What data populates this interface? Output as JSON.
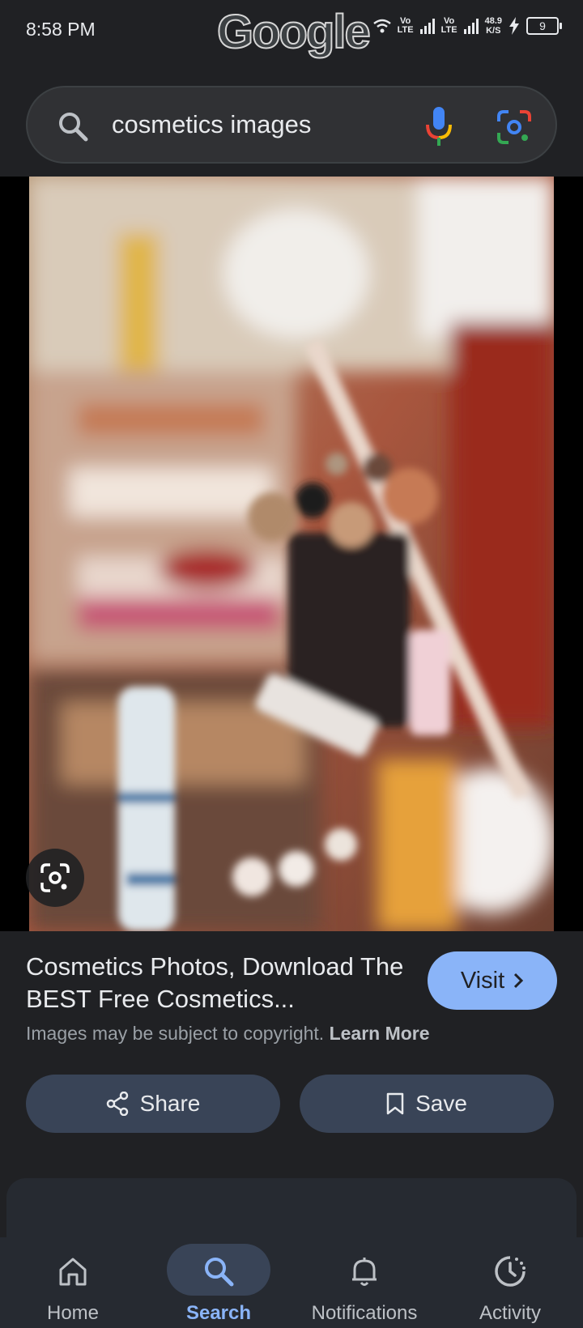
{
  "status_bar": {
    "time": "8:58 PM",
    "logo_text": "Google",
    "sim1_label_top": "Vo",
    "sim1_label_bottom": "LTE",
    "sim2_label_top": "Vo",
    "sim2_label_bottom": "LTE",
    "speed_value": "48.9",
    "speed_unit": "K/S",
    "battery_level": "9"
  },
  "search": {
    "query": "cosmetics images",
    "icons": [
      "search-icon",
      "mic-icon",
      "lens-icon"
    ]
  },
  "image_viewer": {
    "image_alt": "cosmetics brushes and makeup products photo",
    "lens_button_icon": "lens-icon"
  },
  "result": {
    "title": "Cosmetics Photos, Download The BEST Free Cosmetics...",
    "copyright_text": "Images may be subject to copyright.",
    "learn_more": "Learn More",
    "visit_label": "Visit"
  },
  "actions": {
    "share_label": "Share",
    "save_label": "Save"
  },
  "bottom_nav": {
    "items": [
      {
        "label": "Home",
        "icon": "home-icon",
        "active": false
      },
      {
        "label": "Search",
        "icon": "search-icon",
        "active": true
      },
      {
        "label": "Notifications",
        "icon": "bell-icon",
        "active": false
      },
      {
        "label": "Activity",
        "icon": "activity-icon",
        "active": false
      }
    ]
  },
  "colors": {
    "background": "#202124",
    "accent": "#8ab4f8",
    "button": "#394457",
    "nav_background": "#262a31"
  }
}
